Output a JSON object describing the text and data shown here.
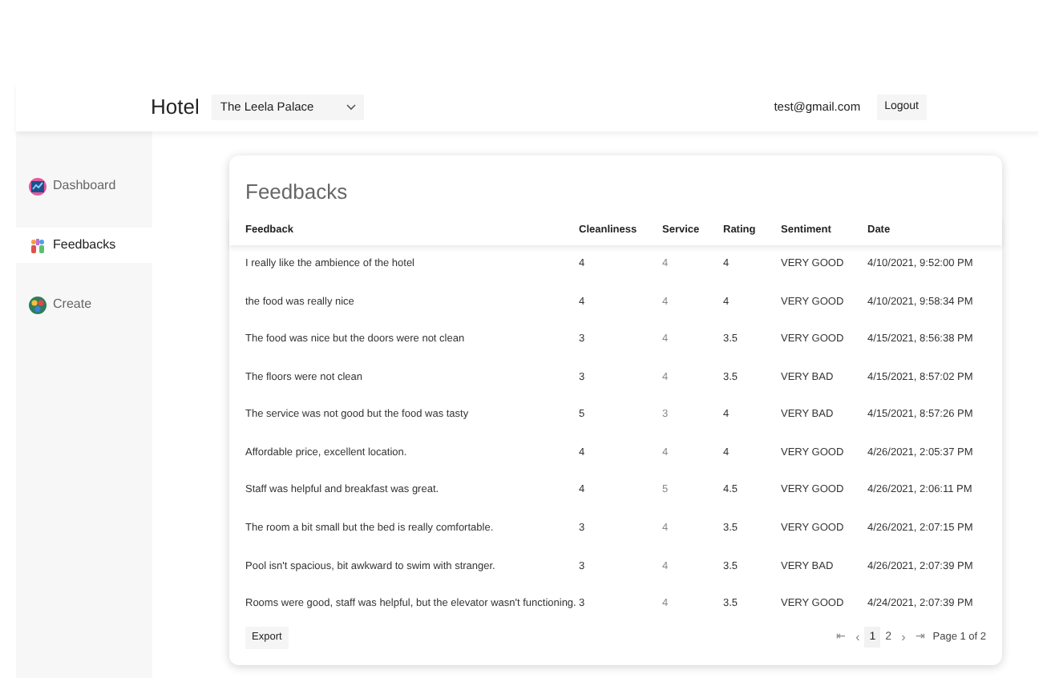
{
  "header": {
    "title": "Hotel",
    "hotel_select": {
      "value": "The Leela Palace"
    },
    "user_email": "test@gmail.com",
    "logout_button": "Logout"
  },
  "sidebar": {
    "items": [
      {
        "label": "Dashboard",
        "selected": false
      },
      {
        "label": "Feedbacks",
        "selected": true
      },
      {
        "label": "Create",
        "selected": false
      }
    ]
  },
  "card": {
    "title": "Feedbacks",
    "table": {
      "columns": [
        "Feedback",
        "Cleanliness",
        "Service",
        "Rating",
        "Sentiment",
        "Date"
      ],
      "rows": [
        [
          "I really like the ambience of the hotel",
          "4",
          "4",
          "4",
          "VERY GOOD",
          "4/10/2021, 9:52:00 PM"
        ],
        [
          "the food was really nice",
          "4",
          "4",
          "4",
          "VERY GOOD",
          "4/10/2021, 9:58:34 PM"
        ],
        [
          "The food was nice but the doors were not clean",
          "3",
          "4",
          "3.5",
          "VERY GOOD",
          "4/15/2021, 8:56:38 PM"
        ],
        [
          "The floors were not clean",
          "3",
          "4",
          "3.5",
          "VERY BAD",
          "4/15/2021, 8:57:02 PM"
        ],
        [
          "The service was not good but the food was tasty",
          "5",
          "3",
          "4",
          "VERY BAD",
          "4/15/2021, 8:57:26 PM"
        ],
        [
          "Affordable price, excellent location.",
          "4",
          "4",
          "4",
          "VERY GOOD",
          "4/26/2021, 2:05:37 PM"
        ],
        [
          "Staff was helpful and breakfast was great.",
          "4",
          "5",
          "4.5",
          "VERY GOOD",
          "4/26/2021, 2:06:11 PM"
        ],
        [
          "The room a bit small but the bed is really comfortable.",
          "3",
          "4",
          "3.5",
          "VERY GOOD",
          "4/26/2021, 2:07:15 PM"
        ],
        [
          "Pool isn't spacious, bit awkward to swim with stranger.",
          "3",
          "4",
          "3.5",
          "VERY BAD",
          "4/26/2021, 2:07:39 PM"
        ],
        [
          "Rooms were good, staff was helpful, but the elevator wasn't functioning.",
          "3",
          "4",
          "3.5",
          "VERY GOOD",
          "4/24/2021, 2:07:39 PM"
        ]
      ]
    },
    "export_button": "Export",
    "pagination": {
      "first": "⇤",
      "prev": "‹",
      "pages": [
        {
          "label": "1",
          "selected": true
        },
        {
          "label": "2",
          "selected": false
        }
      ],
      "next": "›",
      "last": "⇥",
      "page_info": "Page 1 of 2"
    }
  }
}
